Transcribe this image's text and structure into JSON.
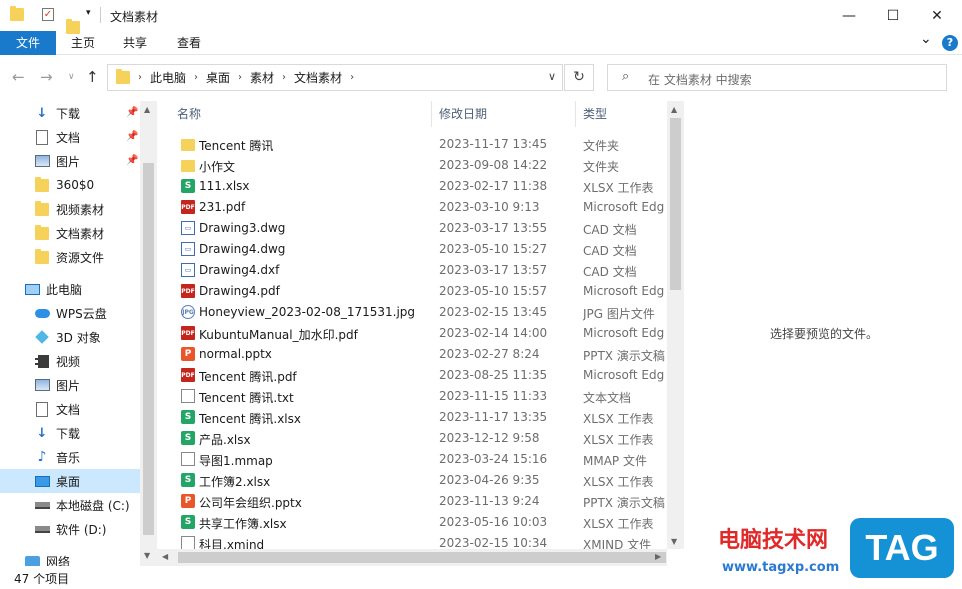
{
  "window": {
    "title": "文档素材",
    "minimize": "—",
    "maximize": "☐",
    "close": "✕"
  },
  "ribbon": {
    "tabs": [
      "文件",
      "主页",
      "共享",
      "查看"
    ],
    "expand": "⌄",
    "help": "?"
  },
  "address": {
    "crumbs": [
      "此电脑",
      "桌面",
      "素材",
      "文档素材"
    ],
    "search_placeholder": "在 文档素材 中搜索"
  },
  "sidebar": {
    "items": [
      {
        "label": "下载",
        "icon": "download-icon",
        "pinned": true
      },
      {
        "label": "文档",
        "icon": "document-icon",
        "pinned": true
      },
      {
        "label": "图片",
        "icon": "picture-icon",
        "pinned": true
      },
      {
        "label": "360$0",
        "icon": "folder-icon",
        "pinned": false
      },
      {
        "label": "视频素材",
        "icon": "folder-icon",
        "pinned": false
      },
      {
        "label": "文档素材",
        "icon": "folder-icon",
        "pinned": false
      },
      {
        "label": "资源文件",
        "icon": "folder-icon",
        "pinned": false
      },
      {
        "label": "此电脑",
        "icon": "pc-icon",
        "pinned": false
      },
      {
        "label": "WPS云盘",
        "icon": "cloud-icon",
        "pinned": false
      },
      {
        "label": "3D 对象",
        "icon": "cube-icon",
        "pinned": false
      },
      {
        "label": "视频",
        "icon": "video-icon",
        "pinned": false
      },
      {
        "label": "图片",
        "icon": "picture-icon",
        "pinned": false
      },
      {
        "label": "文档",
        "icon": "document-icon",
        "pinned": false
      },
      {
        "label": "下载",
        "icon": "download-icon",
        "pinned": false
      },
      {
        "label": "音乐",
        "icon": "music-icon",
        "pinned": false
      },
      {
        "label": "桌面",
        "icon": "desktop-icon",
        "pinned": false,
        "selected": true
      },
      {
        "label": "本地磁盘 (C:)",
        "icon": "drive-icon",
        "pinned": false
      },
      {
        "label": "软件 (D:)",
        "icon": "drive-icon",
        "pinned": false
      },
      {
        "label": "网络",
        "icon": "network-icon",
        "pinned": false
      }
    ]
  },
  "columns": {
    "name": "名称",
    "date": "修改日期",
    "type": "类型"
  },
  "files": [
    {
      "name": "Tencent 腾讯",
      "date": "2023-11-17 13:45",
      "type": "文件夹",
      "kind": "folder"
    },
    {
      "name": "小作文",
      "date": "2023-09-08 14:22",
      "type": "文件夹",
      "kind": "folder"
    },
    {
      "name": "111.xlsx",
      "date": "2023-02-17 11:38",
      "type": "XLSX 工作表",
      "kind": "xlsx"
    },
    {
      "name": "231.pdf",
      "date": "2023-03-10 9:13",
      "type": "Microsoft Edg",
      "kind": "pdf"
    },
    {
      "name": "Drawing3.dwg",
      "date": "2023-03-17 13:55",
      "type": "CAD 文档",
      "kind": "cad"
    },
    {
      "name": "Drawing4.dwg",
      "date": "2023-05-10 15:27",
      "type": "CAD 文档",
      "kind": "cad"
    },
    {
      "name": "Drawing4.dxf",
      "date": "2023-03-17 13:57",
      "type": "CAD 文档",
      "kind": "cad"
    },
    {
      "name": "Drawing4.pdf",
      "date": "2023-05-10 15:57",
      "type": "Microsoft Edg",
      "kind": "pdf"
    },
    {
      "name": "Honeyview_2023-02-08_171531.jpg",
      "date": "2023-02-15 13:45",
      "type": "JPG 图片文件",
      "kind": "jpg"
    },
    {
      "name": "KubuntuManual_加水印.pdf",
      "date": "2023-02-14 14:00",
      "type": "Microsoft Edg",
      "kind": "pdf"
    },
    {
      "name": "normal.pptx",
      "date": "2023-02-27 8:24",
      "type": "PPTX 演示文稿",
      "kind": "pptx"
    },
    {
      "name": "Tencent 腾讯.pdf",
      "date": "2023-08-25 11:35",
      "type": "Microsoft Edg",
      "kind": "pdf"
    },
    {
      "name": "Tencent 腾讯.txt",
      "date": "2023-11-15 11:33",
      "type": "文本文档",
      "kind": "txt"
    },
    {
      "name": "Tencent 腾讯.xlsx",
      "date": "2023-11-17 13:35",
      "type": "XLSX 工作表",
      "kind": "xlsx"
    },
    {
      "name": "产品.xlsx",
      "date": "2023-12-12 9:58",
      "type": "XLSX 工作表",
      "kind": "xlsx"
    },
    {
      "name": "导图1.mmap",
      "date": "2023-03-24 15:16",
      "type": "MMAP 文件",
      "kind": "plain"
    },
    {
      "name": "工作簿2.xlsx",
      "date": "2023-04-26 9:35",
      "type": "XLSX 工作表",
      "kind": "xlsx"
    },
    {
      "name": "公司年会组织.pptx",
      "date": "2023-11-13 9:24",
      "type": "PPTX 演示文稿",
      "kind": "pptx"
    },
    {
      "name": "共享工作簿.xlsx",
      "date": "2023-05-16 10:03",
      "type": "XLSX 工作表",
      "kind": "xlsx"
    },
    {
      "name": "科目.xmind",
      "date": "2023-02-15 10:34",
      "type": "XMIND 文件",
      "kind": "plain"
    }
  ],
  "preview_text": "选择要预览的文件。",
  "status": "47 个项目",
  "watermark": {
    "text": "电脑技术网",
    "url": "www.tagxp.com",
    "tag": "TAG"
  },
  "colors": {
    "accent": "#1979ca",
    "selected": "#cce8ff"
  }
}
